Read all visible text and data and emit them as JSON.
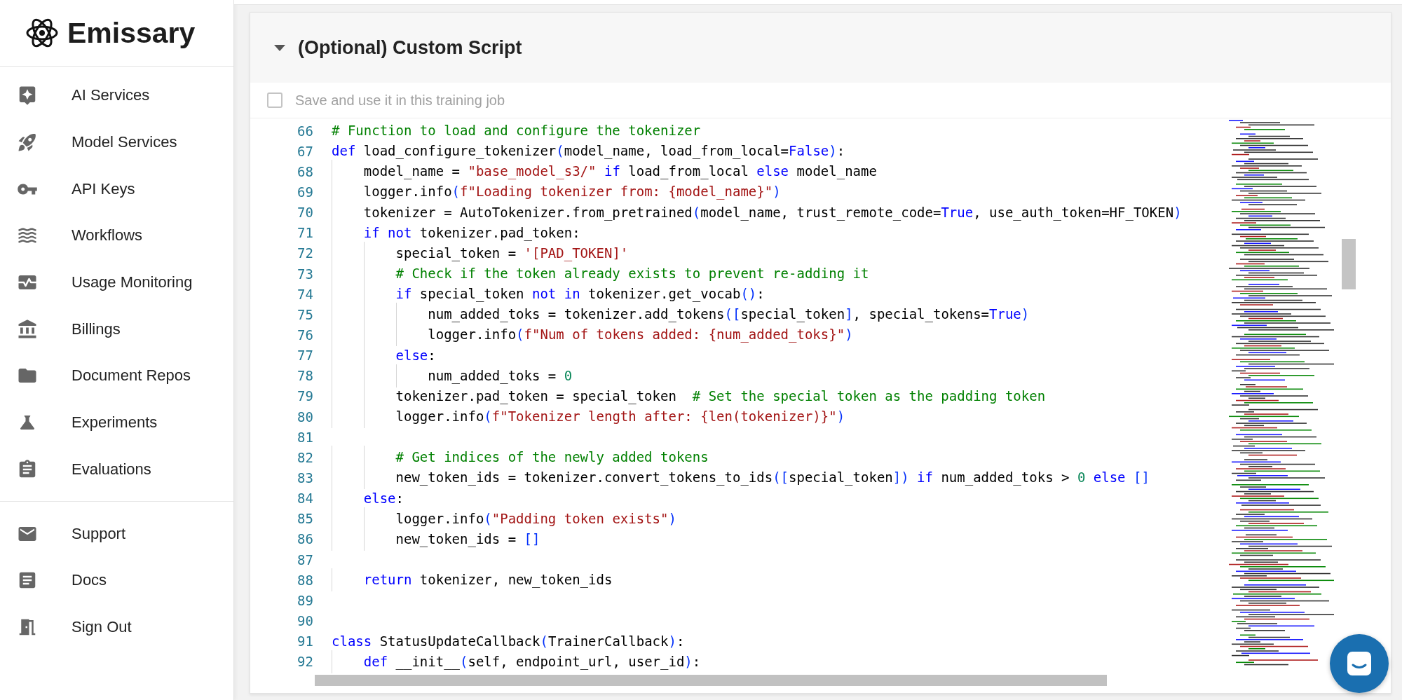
{
  "sidebar": {
    "app_name": "Emissary",
    "items": [
      {
        "label": "AI Services"
      },
      {
        "label": "Model Services"
      },
      {
        "label": "API Keys"
      },
      {
        "label": "Workflows"
      },
      {
        "label": "Usage Monitoring"
      },
      {
        "label": "Billings"
      },
      {
        "label": "Document Repos"
      },
      {
        "label": "Experiments"
      },
      {
        "label": "Evaluations"
      }
    ],
    "footer_items": [
      {
        "label": "Support"
      },
      {
        "label": "Docs"
      },
      {
        "label": "Sign Out"
      }
    ]
  },
  "section": {
    "title": "(Optional) Custom Script",
    "expanded": true,
    "save_checkbox": {
      "label": "Save and use it in this training job",
      "checked": false
    },
    "editor": {
      "lines": [
        {
          "number": "66",
          "tokens": [
            {
              "kind": "comment",
              "text": "# Function to load and configure the tokenizer"
            }
          ]
        },
        {
          "number": "67",
          "tokens": [
            {
              "kind": "keyword",
              "text": "def"
            },
            {
              "kind": "plain",
              "text": " load_configure_tokenizer"
            },
            {
              "kind": "bracket",
              "text": "("
            },
            {
              "kind": "plain",
              "text": "model_name, load_from_local="
            },
            {
              "kind": "keyword",
              "text": "False"
            },
            {
              "kind": "bracket",
              "text": ")"
            },
            {
              "kind": "plain",
              "text": ":"
            }
          ]
        },
        {
          "number": "68",
          "tokens": [
            {
              "kind": "plain",
              "text": "    model_name = "
            },
            {
              "kind": "string",
              "text": "\"base_model_s3/\""
            },
            {
              "kind": "keyword",
              "text": " if"
            },
            {
              "kind": "plain",
              "text": " load_from_local "
            },
            {
              "kind": "keyword",
              "text": "else"
            },
            {
              "kind": "plain",
              "text": " model_name"
            }
          ]
        },
        {
          "number": "69",
          "tokens": [
            {
              "kind": "plain",
              "text": "    logger.info"
            },
            {
              "kind": "bracket",
              "text": "("
            },
            {
              "kind": "string",
              "text": "f\"Loading tokenizer from: {model_name}\""
            },
            {
              "kind": "bracket",
              "text": ")"
            }
          ]
        },
        {
          "number": "70",
          "tokens": [
            {
              "kind": "plain",
              "text": "    tokenizer = AutoTokenizer.from_pretrained"
            },
            {
              "kind": "bracket",
              "text": "("
            },
            {
              "kind": "plain",
              "text": "model_name, trust_remote_code="
            },
            {
              "kind": "keyword",
              "text": "True"
            },
            {
              "kind": "plain",
              "text": ", use_auth_token=HF_TOKEN"
            },
            {
              "kind": "bracket",
              "text": ")"
            }
          ]
        },
        {
          "number": "71",
          "tokens": [
            {
              "kind": "keyword",
              "text": "    if not"
            },
            {
              "kind": "plain",
              "text": " tokenizer.pad_token:"
            }
          ]
        },
        {
          "number": "72",
          "tokens": [
            {
              "kind": "plain",
              "text": "        special_token = "
            },
            {
              "kind": "string",
              "text": "'[PAD_TOKEN]'"
            }
          ]
        },
        {
          "number": "73",
          "tokens": [
            {
              "kind": "comment",
              "text": "        # Check if the token already exists to prevent re-adding it"
            }
          ]
        },
        {
          "number": "74",
          "tokens": [
            {
              "kind": "keyword",
              "text": "        if"
            },
            {
              "kind": "plain",
              "text": " special_token "
            },
            {
              "kind": "keyword",
              "text": "not in"
            },
            {
              "kind": "plain",
              "text": " tokenizer.get_vocab"
            },
            {
              "kind": "bracket",
              "text": "()"
            },
            {
              "kind": "plain",
              "text": ":"
            }
          ]
        },
        {
          "number": "75",
          "tokens": [
            {
              "kind": "plain",
              "text": "            num_added_toks = tokenizer.add_tokens"
            },
            {
              "kind": "bracket",
              "text": "(["
            },
            {
              "kind": "plain",
              "text": "special_token"
            },
            {
              "kind": "bracket",
              "text": "]"
            },
            {
              "kind": "plain",
              "text": ", special_tokens="
            },
            {
              "kind": "keyword",
              "text": "True"
            },
            {
              "kind": "bracket",
              "text": ")"
            }
          ]
        },
        {
          "number": "76",
          "tokens": [
            {
              "kind": "plain",
              "text": "            logger.info"
            },
            {
              "kind": "bracket",
              "text": "("
            },
            {
              "kind": "string",
              "text": "f\"Num of tokens added: {num_added_toks}\""
            },
            {
              "kind": "bracket",
              "text": ")"
            }
          ]
        },
        {
          "number": "77",
          "tokens": [
            {
              "kind": "keyword",
              "text": "        else"
            },
            {
              "kind": "plain",
              "text": ":"
            }
          ]
        },
        {
          "number": "78",
          "tokens": [
            {
              "kind": "plain",
              "text": "            num_added_toks = "
            },
            {
              "kind": "number",
              "text": "0"
            }
          ]
        },
        {
          "number": "79",
          "tokens": [
            {
              "kind": "plain",
              "text": "        tokenizer.pad_token = special_token  "
            },
            {
              "kind": "comment",
              "text": "# Set the special token as the padding token"
            }
          ]
        },
        {
          "number": "80",
          "tokens": [
            {
              "kind": "plain",
              "text": "        logger.info"
            },
            {
              "kind": "bracket",
              "text": "("
            },
            {
              "kind": "string",
              "text": "f\"Tokenizer length after: {len(tokenizer)}\""
            },
            {
              "kind": "bracket",
              "text": ")"
            }
          ]
        },
        {
          "number": "81"
        },
        {
          "number": "82",
          "tokens": [
            {
              "kind": "comment",
              "text": "        # Get indices of the newly added tokens"
            }
          ]
        },
        {
          "number": "83",
          "tokens": [
            {
              "kind": "plain",
              "text": "        new_token_ids = tokenizer.convert_tokens_to_ids"
            },
            {
              "kind": "bracket",
              "text": "(["
            },
            {
              "kind": "plain",
              "text": "special_token"
            },
            {
              "kind": "bracket",
              "text": "])"
            },
            {
              "kind": "keyword",
              "text": " if"
            },
            {
              "kind": "plain",
              "text": " num_added_toks > "
            },
            {
              "kind": "number",
              "text": "0"
            },
            {
              "kind": "keyword",
              "text": " else"
            },
            {
              "kind": "bracket",
              "text": " []"
            }
          ]
        },
        {
          "number": "84",
          "tokens": [
            {
              "kind": "keyword",
              "text": "    else"
            },
            {
              "kind": "plain",
              "text": ":"
            }
          ]
        },
        {
          "number": "85",
          "tokens": [
            {
              "kind": "plain",
              "text": "        logger.info"
            },
            {
              "kind": "bracket",
              "text": "("
            },
            {
              "kind": "string",
              "text": "\"Padding token exists\""
            },
            {
              "kind": "bracket",
              "text": ")"
            }
          ]
        },
        {
          "number": "86",
          "tokens": [
            {
              "kind": "plain",
              "text": "        new_token_ids = "
            },
            {
              "kind": "bracket",
              "text": "[]"
            }
          ]
        },
        {
          "number": "87"
        },
        {
          "number": "88",
          "tokens": [
            {
              "kind": "keyword",
              "text": "    return"
            },
            {
              "kind": "plain",
              "text": " tokenizer, new_token_ids"
            }
          ]
        },
        {
          "number": "89"
        },
        {
          "number": "90"
        },
        {
          "number": "91",
          "tokens": [
            {
              "kind": "keyword",
              "text": "class"
            },
            {
              "kind": "plain",
              "text": " StatusUpdateCallback"
            },
            {
              "kind": "bracket",
              "text": "("
            },
            {
              "kind": "plain",
              "text": "TrainerCallback"
            },
            {
              "kind": "bracket",
              "text": ")"
            },
            {
              "kind": "plain",
              "text": ":"
            }
          ]
        },
        {
          "number": "92",
          "tokens": [
            {
              "kind": "keyword",
              "text": "    def"
            },
            {
              "kind": "plain",
              "text": " __init__"
            },
            {
              "kind": "bracket",
              "text": "("
            },
            {
              "kind": "plain",
              "text": "self, endpoint_url, user_id"
            },
            {
              "kind": "bracket",
              "text": ")"
            },
            {
              "kind": "plain",
              "text": ":"
            }
          ]
        }
      ]
    }
  }
}
